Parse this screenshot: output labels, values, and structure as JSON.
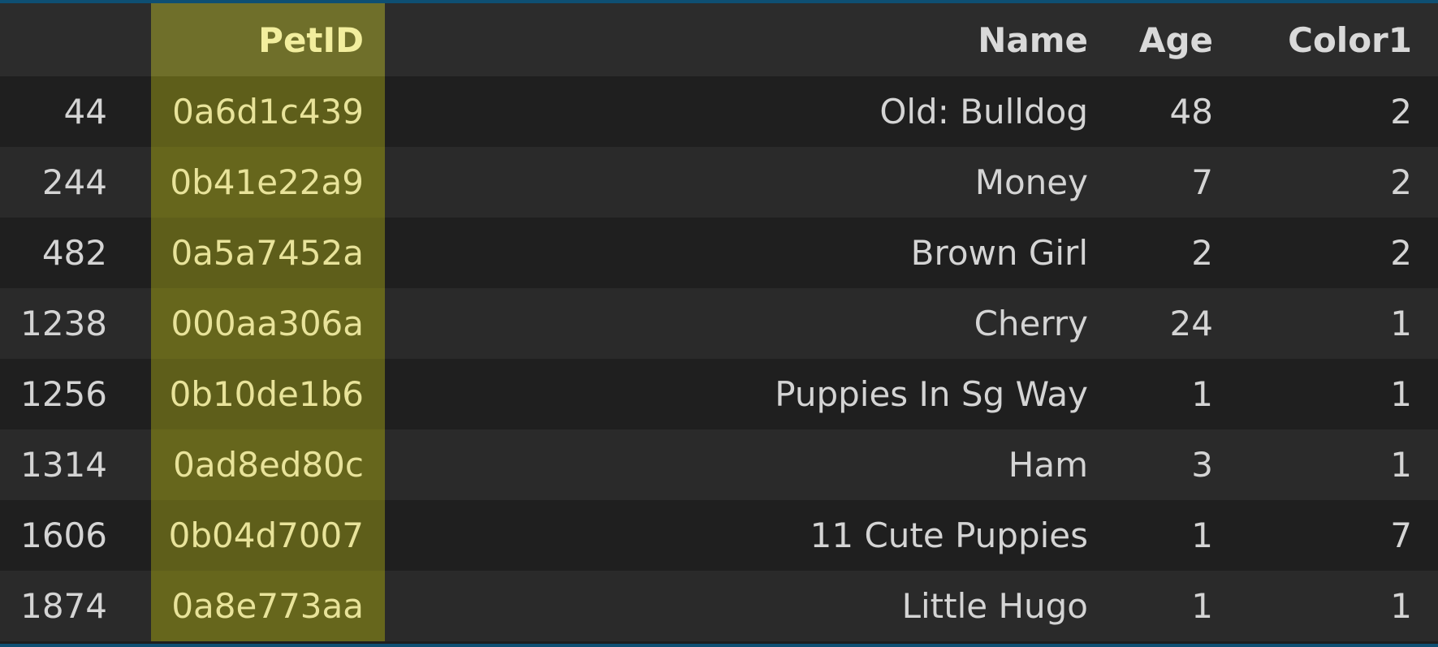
{
  "table": {
    "columns": {
      "index": "",
      "petid": "PetID",
      "name": "Name",
      "age": "Age",
      "color1": "Color1"
    },
    "rows": [
      {
        "index": "44",
        "petid": "0a6d1c439",
        "name": "Old: Bulldog",
        "age": "48",
        "color1": "2"
      },
      {
        "index": "244",
        "petid": "0b41e22a9",
        "name": "Money",
        "age": "7",
        "color1": "2"
      },
      {
        "index": "482",
        "petid": "0a5a7452a",
        "name": "Brown Girl",
        "age": "2",
        "color1": "2"
      },
      {
        "index": "1238",
        "petid": "000aa306a",
        "name": "Cherry",
        "age": "24",
        "color1": "1"
      },
      {
        "index": "1256",
        "petid": "0b10de1b6",
        "name": "Puppies In Sg Way",
        "age": "1",
        "color1": "1"
      },
      {
        "index": "1314",
        "petid": "0ad8ed80c",
        "name": "Ham",
        "age": "3",
        "color1": "1"
      },
      {
        "index": "1606",
        "petid": "0b04d7007",
        "name": "11 Cute Puppies",
        "age": "1",
        "color1": "7"
      },
      {
        "index": "1874",
        "petid": "0a8e773aa",
        "name": "Little Hugo",
        "age": "1",
        "color1": "1"
      }
    ]
  },
  "colors": {
    "highlight_column": "#5e5e1a",
    "highlight_text": "#e8e39a",
    "border_accent": "#0e4f73"
  }
}
